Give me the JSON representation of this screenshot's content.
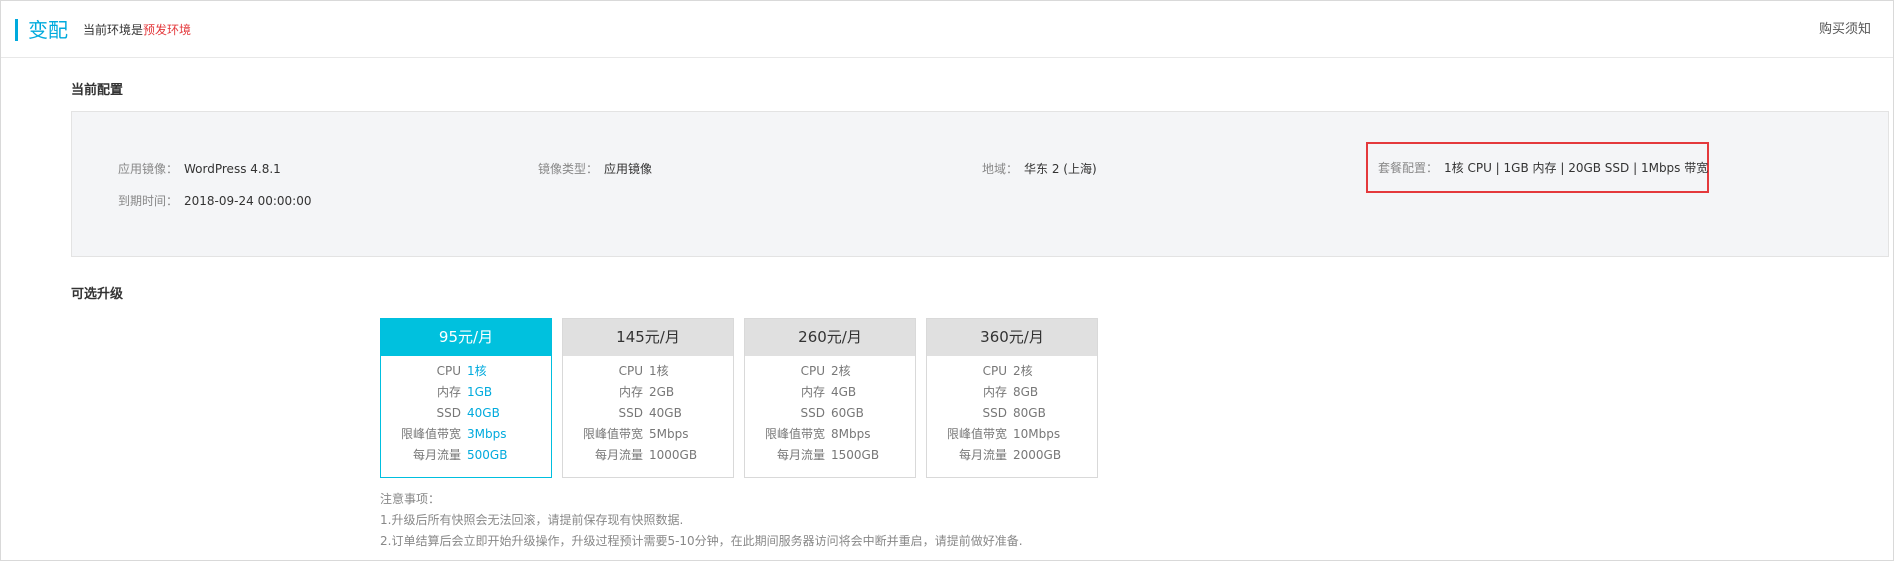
{
  "header": {
    "title": "变配",
    "env_prefix": "当前环境是",
    "env_value": "预发环境",
    "buy_note": "购买须知"
  },
  "current_config": {
    "section_title": "当前配置",
    "image_label": "应用镜像：",
    "image_value": "WordPress 4.8.1",
    "type_label": "镜像类型：",
    "type_value": "应用镜像",
    "region_label": "地域：",
    "region_value": "华东 2 (上海)",
    "package_label": "套餐配置：",
    "package_value": "1核 CPU | 1GB 内存 | 20GB SSD | 1Mbps 带宽",
    "expire_label": "到期时间：",
    "expire_value": "2018-09-24 00:00:00",
    "highlight_color": "#e4393c"
  },
  "upgrade": {
    "section_title": "可选升级",
    "accent_color": "#00c1de",
    "plans": [
      {
        "price": "95元/月",
        "selected": true,
        "rows": [
          {
            "label": "CPU",
            "value": "1核"
          },
          {
            "label": "内存",
            "value": "1GB"
          },
          {
            "label": "SSD",
            "value": "40GB"
          },
          {
            "label": "限峰值带宽",
            "value": "3Mbps"
          },
          {
            "label": "每月流量",
            "value": "500GB"
          }
        ]
      },
      {
        "price": "145元/月",
        "selected": false,
        "rows": [
          {
            "label": "CPU",
            "value": "1核"
          },
          {
            "label": "内存",
            "value": "2GB"
          },
          {
            "label": "SSD",
            "value": "40GB"
          },
          {
            "label": "限峰值带宽",
            "value": "5Mbps"
          },
          {
            "label": "每月流量",
            "value": "1000GB"
          }
        ]
      },
      {
        "price": "260元/月",
        "selected": false,
        "rows": [
          {
            "label": "CPU",
            "value": "2核"
          },
          {
            "label": "内存",
            "value": "4GB"
          },
          {
            "label": "SSD",
            "value": "60GB"
          },
          {
            "label": "限峰值带宽",
            "value": "8Mbps"
          },
          {
            "label": "每月流量",
            "value": "1500GB"
          }
        ]
      },
      {
        "price": "360元/月",
        "selected": false,
        "rows": [
          {
            "label": "CPU",
            "value": "2核"
          },
          {
            "label": "内存",
            "value": "8GB"
          },
          {
            "label": "SSD",
            "value": "80GB"
          },
          {
            "label": "限峰值带宽",
            "value": "10Mbps"
          },
          {
            "label": "每月流量",
            "value": "2000GB"
          }
        ]
      }
    ]
  },
  "notes": {
    "title": "注意事项：",
    "items": [
      "1.升级后所有快照会无法回滚，请提前保存现有快照数据.",
      "2.订单结算后会立即开始升级操作，升级过程预计需要5-10分钟，在此期间服务器访问将会中断并重启，请提前做好准备."
    ]
  }
}
